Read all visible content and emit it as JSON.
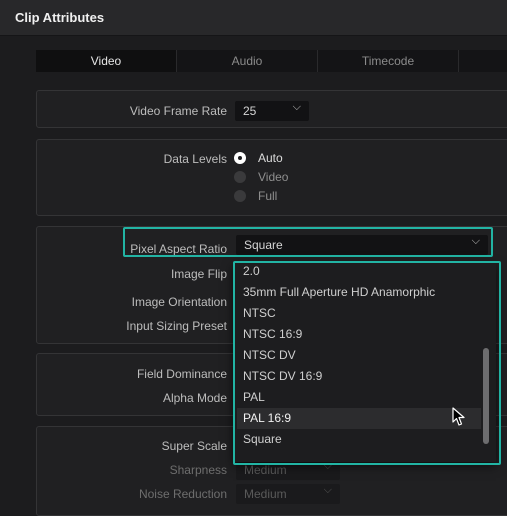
{
  "window": {
    "title": "Clip Attributes"
  },
  "tabs": [
    {
      "label": "Video",
      "active": true
    },
    {
      "label": "Audio",
      "active": false
    },
    {
      "label": "Timecode",
      "active": false
    }
  ],
  "video_frame_rate": {
    "label": "Video Frame Rate",
    "value": "25"
  },
  "data_levels": {
    "label": "Data Levels",
    "options": [
      "Auto",
      "Video",
      "Full"
    ],
    "selected": "Auto"
  },
  "pixel_aspect_ratio": {
    "label": "Pixel Aspect Ratio",
    "value": "Square"
  },
  "image_flip": {
    "label": "Image Flip"
  },
  "image_orientation": {
    "label": "Image Orientation"
  },
  "input_sizing_preset": {
    "label": "Input Sizing Preset"
  },
  "dropdown": {
    "options": [
      "2.0",
      "35mm Full Aperture HD Anamorphic",
      "NTSC",
      "NTSC 16:9",
      "NTSC DV",
      "NTSC DV 16:9",
      "PAL",
      "PAL 16:9",
      "Square"
    ],
    "hovered": "PAL 16:9"
  },
  "field_dominance": {
    "label": "Field Dominance"
  },
  "alpha_mode": {
    "label": "Alpha Mode"
  },
  "super_scale": {
    "label": "Super Scale"
  },
  "sharpness": {
    "label": "Sharpness",
    "value": "Medium"
  },
  "noise_reduction": {
    "label": "Noise Reduction",
    "value": "Medium"
  },
  "colors": {
    "highlight": "#22b4a4",
    "background": "#1c1c1e"
  }
}
